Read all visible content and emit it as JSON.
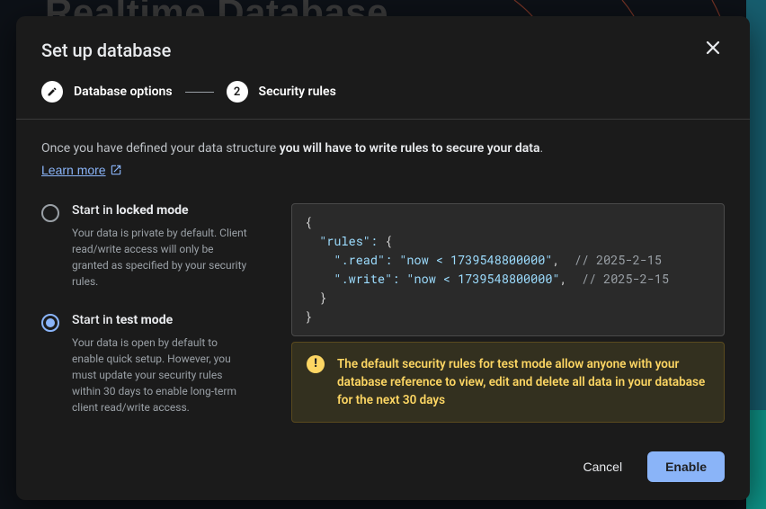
{
  "background": {
    "page_title": "Realtime Database"
  },
  "modal": {
    "title": "Set up database",
    "close_aria": "Close",
    "stepper": {
      "step1_label": "Database options",
      "step2_num": "2",
      "step2_label": "Security rules"
    },
    "intro_prefix": "Once you have defined your data structure ",
    "intro_bold": "you will have to write rules to secure your data",
    "intro_suffix": ".",
    "learn_more": "Learn more",
    "options": {
      "locked": {
        "title_prefix": "Start in ",
        "title_em": "locked mode",
        "desc": "Your data is private by default. Client read/write access will only be granted as specified by your security rules."
      },
      "test": {
        "title_prefix": "Start in ",
        "title_em": "test mode",
        "desc": "Your data is open by default to enable quick setup. However, you must update your security rules within 30 days to enable long-term client read/write access."
      },
      "selected": "test"
    },
    "code": {
      "l1": "{",
      "l2a": "  \"rules\": ",
      "l2b": "{",
      "l3a": "    \".read\": ",
      "l3b": "\"now < 1739548800000\"",
      "l3c": ",  ",
      "l3d": "// 2025-2-15",
      "l4a": "    \".write\": ",
      "l4b": "\"now < 1739548800000\"",
      "l4c": ",  ",
      "l4d": "// 2025-2-15",
      "l5": "  }",
      "l6": "}"
    },
    "warning": "The default security rules for test mode allow anyone with your database reference to view, edit and delete all data in your database for the next 30 days",
    "footer": {
      "cancel": "Cancel",
      "enable": "Enable"
    }
  }
}
